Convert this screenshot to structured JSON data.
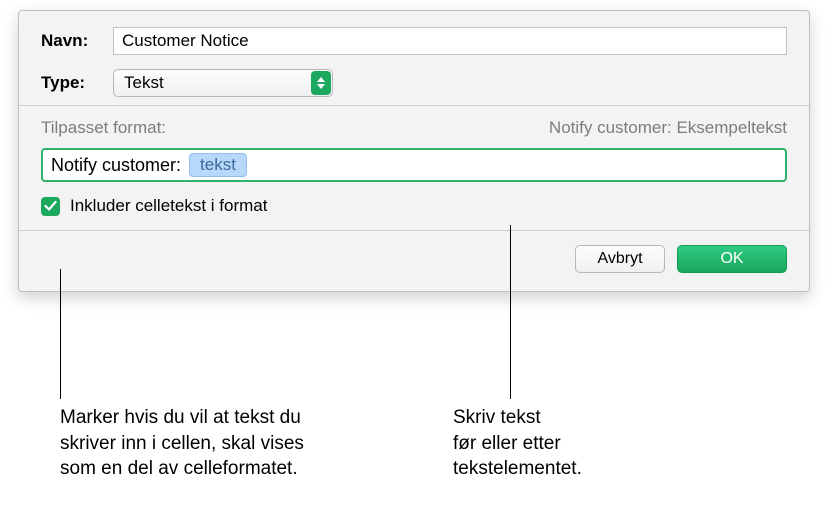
{
  "dialog": {
    "name_label": "Navn:",
    "name_value": "Customer Notice",
    "type_label": "Type:",
    "type_value": "Tekst",
    "format_header": "Tilpasset format:",
    "preview": "Notify customer: Eksempeltekst",
    "format_prefix": "Notify customer:",
    "format_token": "tekst",
    "checkbox_label": "Inkluder celletekst i format",
    "cancel": "Avbryt",
    "ok": "OK"
  },
  "callouts": {
    "left": "Marker hvis du vil at tekst du\nskriver inn i cellen, skal vises\nsom en del av celleformatet.",
    "right": "Skriv tekst\nfør eller etter\ntekstelementet."
  }
}
